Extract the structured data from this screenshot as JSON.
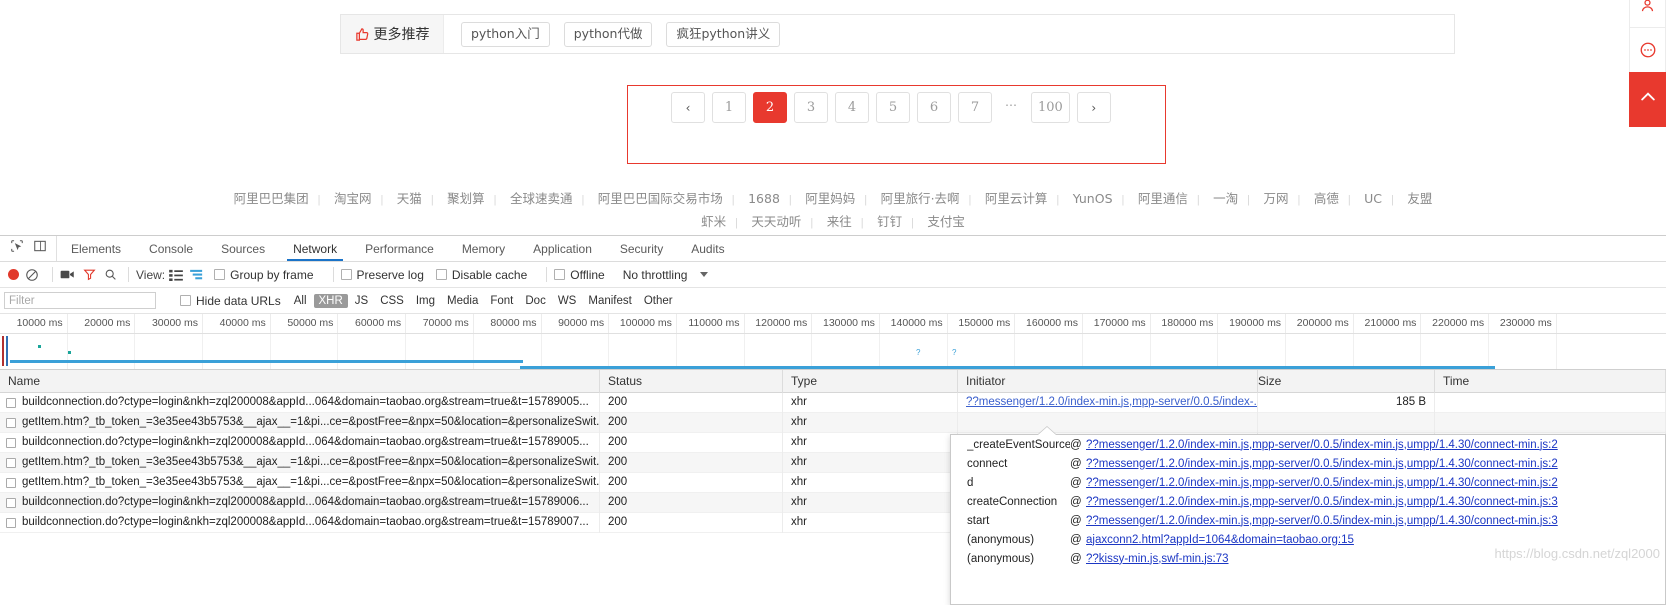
{
  "page": {
    "recommend": {
      "label": "更多推荐",
      "icon": "thumbs-up-icon",
      "tags": [
        "python入门",
        "python代做",
        "疯狂python讲义"
      ]
    },
    "pagination": {
      "prev_label": "‹",
      "next_label": "›",
      "gap_label": "⋯",
      "pages": [
        "1",
        "2",
        "3",
        "4",
        "5",
        "6",
        "7"
      ],
      "last_page": "100",
      "active_page": "2",
      "highlight_color": "#e8392e"
    },
    "footer": {
      "row1": [
        "阿里巴巴集团",
        "淘宝网",
        "天猫",
        "聚划算",
        "全球速卖通",
        "阿里巴巴国际交易市场",
        "1688",
        "阿里妈妈",
        "阿里旅行·去啊",
        "阿里云计算",
        "YunOS",
        "阿里通信",
        "一淘",
        "万网",
        "高德",
        "UC",
        "友盟"
      ],
      "row2": [
        "虾米",
        "天天动听",
        "来往",
        "钉钉",
        "支付宝"
      ],
      "separator": "|"
    },
    "float_bar": {
      "items": [
        "user-icon",
        "message-icon",
        "scroll-to-top-icon"
      ],
      "top_button_color": "#e8392e"
    }
  },
  "devtools": {
    "icons": [
      "inspect-element-icon",
      "device-toolbar-icon"
    ],
    "tabs": [
      {
        "label": "Elements",
        "active": false
      },
      {
        "label": "Console",
        "active": false
      },
      {
        "label": "Sources",
        "active": false
      },
      {
        "label": "Network",
        "active": true
      },
      {
        "label": "Performance",
        "active": false
      },
      {
        "label": "Memory",
        "active": false
      },
      {
        "label": "Application",
        "active": false
      },
      {
        "label": "Security",
        "active": false
      },
      {
        "label": "Audits",
        "active": false
      }
    ],
    "active_tab_underline_color": "#1a73c8",
    "toolbar": {
      "record_icon": "record-stop-icon",
      "clear_icon": "clear-icon",
      "camera_icon": "screenshot-camera-icon",
      "filter_icon": "filter-funnel-icon",
      "search_icon": "search-icon",
      "view_label": "View:",
      "view_list_icon": "view-list-icon",
      "view_waterfall_icon": "view-waterfall-icon",
      "group_by_frame": {
        "label": "Group by frame",
        "checked": false
      },
      "preserve_log": {
        "label": "Preserve log",
        "checked": false
      },
      "disable_cache": {
        "label": "Disable cache",
        "checked": false
      },
      "offline": {
        "label": "Offline",
        "checked": false
      },
      "throttling": "No throttling",
      "throttling_caret": "chevron-down-icon"
    },
    "filterbar": {
      "placeholder": "Filter",
      "value": "",
      "hide_data_urls": {
        "label": "Hide data URLs",
        "checked": false
      },
      "types": [
        "All",
        "XHR",
        "JS",
        "CSS",
        "Img",
        "Media",
        "Font",
        "Doc",
        "WS",
        "Manifest",
        "Other"
      ],
      "active_type": "XHR"
    },
    "timeline": {
      "ticks": [
        "10000 ms",
        "20000 ms",
        "30000 ms",
        "40000 ms",
        "50000 ms",
        "60000 ms",
        "70000 ms",
        "80000 ms",
        "90000 ms",
        "100000 ms",
        "110000 ms",
        "120000 ms",
        "130000 ms",
        "140000 ms",
        "150000 ms",
        "160000 ms",
        "170000 ms",
        "180000 ms",
        "190000 ms",
        "200000 ms",
        "210000 ms",
        "220000 ms",
        "230000 ms"
      ]
    },
    "table": {
      "columns": [
        "Name",
        "Status",
        "Type",
        "Initiator",
        "Size",
        "Time"
      ],
      "rows": [
        {
          "name": "buildconnection.do?ctype=login&nkh=zql200008&appId...064&domain=taobao.org&stream=true&t=15789005...",
          "status": "200",
          "type": "xhr",
          "initiator": "??messenger/1.2.0/index-min.js,mpp-server/0.0.5/index-...",
          "size": "185 B",
          "time": ""
        },
        {
          "name": "getItem.htm?_tb_token_=3e35ee43b5753&__ajax__=1&pi...ce=&postFree=&npx=50&location=&personalizeSwit...",
          "status": "200",
          "type": "xhr",
          "initiator": "",
          "size": "",
          "time": ""
        },
        {
          "name": "buildconnection.do?ctype=login&nkh=zql200008&appId...064&domain=taobao.org&stream=true&t=15789005...",
          "status": "200",
          "type": "xhr",
          "initiator": "",
          "size": "",
          "time": ""
        },
        {
          "name": "getItem.htm?_tb_token_=3e35ee43b5753&__ajax__=1&pi...ce=&postFree=&npx=50&location=&personalizeSwit...",
          "status": "200",
          "type": "xhr",
          "initiator": "",
          "size": "",
          "time": ""
        },
        {
          "name": "getItem.htm?_tb_token_=3e35ee43b5753&__ajax__=1&pi...ce=&postFree=&npx=50&location=&personalizeSwit...",
          "status": "200",
          "type": "xhr",
          "initiator": "",
          "size": "",
          "time": ""
        },
        {
          "name": "buildconnection.do?ctype=login&nkh=zql200008&appId...064&domain=taobao.org&stream=true&t=15789006...",
          "status": "200",
          "type": "xhr",
          "initiator": "",
          "size": "",
          "time": ""
        },
        {
          "name": "buildconnection.do?ctype=login&nkh=zql200008&appId...064&domain=taobao.org&stream=true&t=15789007...",
          "status": "200",
          "type": "xhr",
          "initiator": "",
          "size": "",
          "time": ""
        }
      ]
    },
    "initiator_popup": {
      "at": "@",
      "entries": [
        {
          "fn": "_createEventSource",
          "url": "??messenger/1.2.0/index-min.js,mpp-server/0.0.5/index-min.js,umpp/1.4.30/connect-min.js:2"
        },
        {
          "fn": "connect",
          "url": "??messenger/1.2.0/index-min.js,mpp-server/0.0.5/index-min.js,umpp/1.4.30/connect-min.js:2"
        },
        {
          "fn": "d",
          "url": "??messenger/1.2.0/index-min.js,mpp-server/0.0.5/index-min.js,umpp/1.4.30/connect-min.js:2"
        },
        {
          "fn": "createConnection",
          "url": "??messenger/1.2.0/index-min.js,mpp-server/0.0.5/index-min.js,umpp/1.4.30/connect-min.js:3"
        },
        {
          "fn": "start",
          "url": "??messenger/1.2.0/index-min.js,mpp-server/0.0.5/index-min.js,umpp/1.4.30/connect-min.js:3"
        },
        {
          "fn": "(anonymous)",
          "url": "ajaxconn2.html?appId=1064&domain=taobao.org:15"
        },
        {
          "fn": "(anonymous)",
          "url": "??kissy-min.js,swf-min.js:73"
        }
      ]
    }
  },
  "watermark": "https://blog.csdn.net/zql2000"
}
